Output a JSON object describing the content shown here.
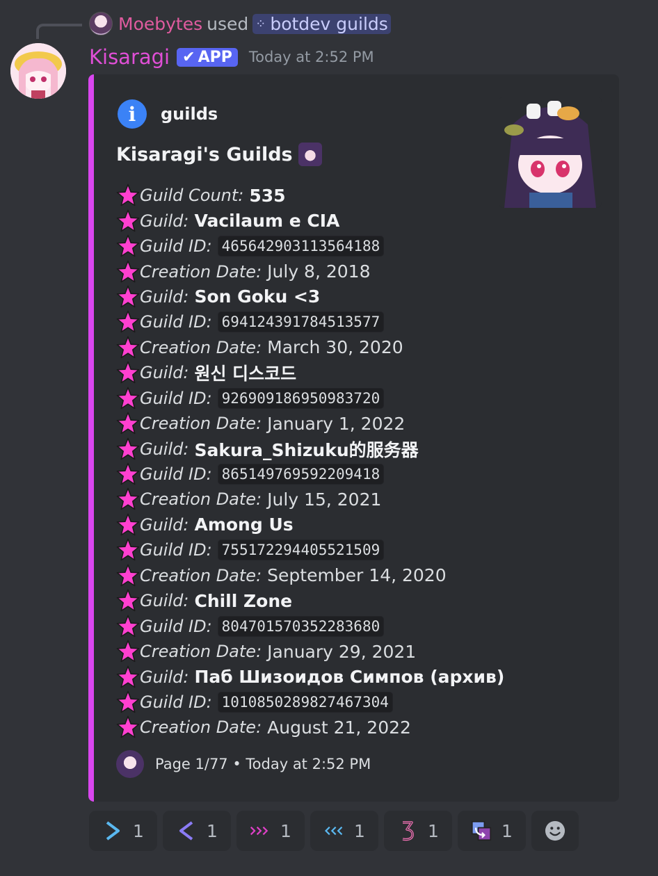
{
  "reply": {
    "user": "Moebytes",
    "used": "used",
    "command": "botdev guilds",
    "command_icon": "slash-command-icon"
  },
  "message": {
    "bot_name": "Kisaragi",
    "badge": "APP",
    "timestamp": "Today at 2:52 PM"
  },
  "embed": {
    "accent_color": "#d946ef",
    "author_icon": "info-icon",
    "author_name": "guilds",
    "title": "Kisaragi's Guilds",
    "rows": [
      {
        "label": "Guild Count:",
        "value": "535",
        "style": "b"
      },
      {
        "label": "Guild:",
        "value": "Vacilaum e CIA",
        "style": "b"
      },
      {
        "label": "Guild ID:",
        "value": "465642903113564188",
        "style": "code"
      },
      {
        "label": "Creation Date:",
        "value": "July 8, 2018",
        "style": "t"
      },
      {
        "label": "Guild:",
        "value": "Son Goku <3",
        "style": "b"
      },
      {
        "label": "Guild ID:",
        "value": "694124391784513577",
        "style": "code"
      },
      {
        "label": "Creation Date:",
        "value": "March 30, 2020",
        "style": "t"
      },
      {
        "label": "Guild:",
        "value": "원신 디스코드",
        "style": "b"
      },
      {
        "label": "Guild ID:",
        "value": "926909186950983720",
        "style": "code"
      },
      {
        "label": "Creation Date:",
        "value": "January 1, 2022",
        "style": "t"
      },
      {
        "label": "Guild:",
        "value": "Sakura_Shizuku的服务器",
        "style": "b"
      },
      {
        "label": "Guild ID:",
        "value": "865149769592209418",
        "style": "code"
      },
      {
        "label": "Creation Date:",
        "value": "July 15, 2021",
        "style": "t"
      },
      {
        "label": "Guild:",
        "value": "Among Us",
        "style": "b"
      },
      {
        "label": "Guild ID:",
        "value": "755172294405521509",
        "style": "code"
      },
      {
        "label": "Creation Date:",
        "value": "September 14, 2020",
        "style": "t"
      },
      {
        "label": "Guild:",
        "value": "Chill Zone",
        "style": "b"
      },
      {
        "label": "Guild ID:",
        "value": "804701570352283680",
        "style": "code"
      },
      {
        "label": "Creation Date:",
        "value": "January 29, 2021",
        "style": "t"
      },
      {
        "label": "Guild:",
        "value": "Паб Шизоидов Симпов (архив)",
        "style": "b"
      },
      {
        "label": "Guild ID:",
        "value": "1010850289827467304",
        "style": "code"
      },
      {
        "label": "Creation Date:",
        "value": "August 21, 2022",
        "style": "t"
      }
    ],
    "footer": "Page 1/77 • Today at 2:52 PM"
  },
  "reactions": [
    {
      "icon": "right-arrow-icon",
      "count": "1"
    },
    {
      "icon": "left-arrow-icon",
      "count": "1"
    },
    {
      "icon": "fast-forward-icon",
      "count": "1"
    },
    {
      "icon": "rewind-icon",
      "count": "1"
    },
    {
      "icon": "number-3-icon",
      "count": "1"
    },
    {
      "icon": "swap-icon",
      "count": "1"
    }
  ],
  "colors": {
    "background": "#313338",
    "embed_bg": "#2b2d31",
    "bot_name": "#e04fd6",
    "reply_user": "#e05b9f",
    "app_badge": "#5865f2",
    "star": "#ff40d0"
  }
}
